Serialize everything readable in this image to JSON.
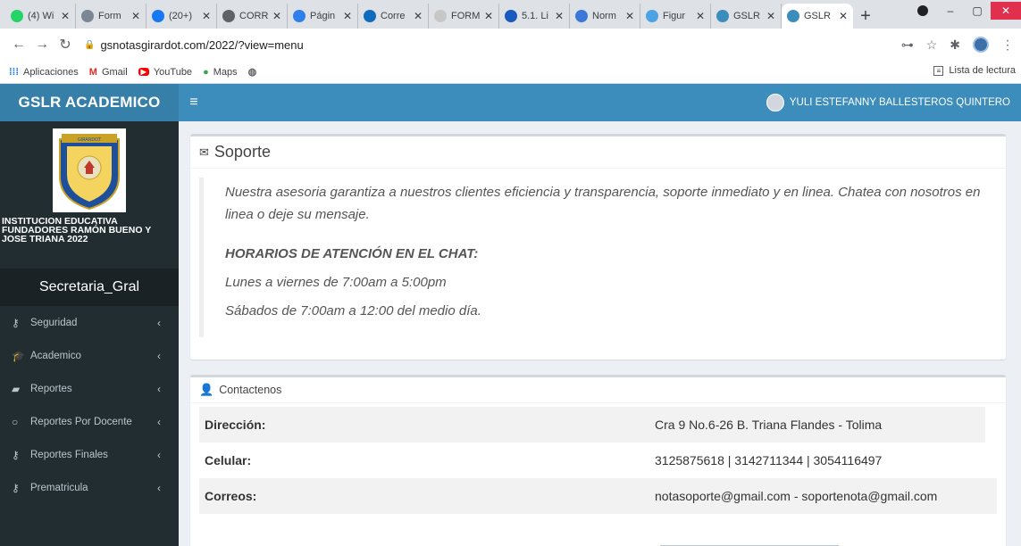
{
  "browser": {
    "tabs": [
      {
        "title": "(4) Wi",
        "color": "#25d366"
      },
      {
        "title": "Form",
        "color": "#7b8794"
      },
      {
        "title": "(20+)",
        "color": "#1877f2"
      },
      {
        "title": "CORR",
        "color": "#5f6368"
      },
      {
        "title": "Págin",
        "color": "#2f80ed"
      },
      {
        "title": "Corre",
        "color": "#0f6cbd"
      },
      {
        "title": "FORM",
        "color": "#c7c7c7"
      },
      {
        "title": "5.1. Li",
        "color": "#185abd"
      },
      {
        "title": "Norm",
        "color": "#3c78d8"
      },
      {
        "title": "Figur",
        "color": "#4ba3e3"
      },
      {
        "title": "GSLR",
        "color": "#3c8dbc"
      },
      {
        "title": "GSLR",
        "color": "#3c8dbc"
      }
    ],
    "url": "gsnotasgirardot.com/2022/?view=menu",
    "bookmarks": [
      {
        "label": "Aplicaciones",
        "icon": "apps-grid-icon"
      },
      {
        "label": "Gmail",
        "icon": "gmail-icon"
      },
      {
        "label": "YouTube",
        "icon": "youtube-icon"
      },
      {
        "label": "Maps",
        "icon": "maps-icon"
      },
      {
        "label": "",
        "icon": "globe-icon"
      }
    ],
    "reading_list": "Lista de lectura"
  },
  "app": {
    "brand": "GSLR ACADEMICO",
    "school_name": "INSTITUCION EDUCATIVA FUNDADORES RAMÓN BUENO Y JOSE TRIANA 2022",
    "crest_text": "GIRARDOT",
    "role": "Secretaria_Gral",
    "user_name": "YULI ESTEFANNY BALLESTEROS QUINTERO",
    "menu": [
      {
        "label": "Seguridad",
        "icon": "key-icon"
      },
      {
        "label": "Academico",
        "icon": "graduation-cap-icon"
      },
      {
        "label": "Reportes",
        "icon": "book-icon"
      },
      {
        "label": "Reportes Por Docente",
        "icon": "circle-icon"
      },
      {
        "label": "Reportes Finales",
        "icon": "key-icon"
      },
      {
        "label": "Prematricula",
        "icon": "key-icon"
      }
    ]
  },
  "support": {
    "title": "Soporte",
    "intro": "Nuestra asesoria garantiza a nuestros clientes eficiencia y transparencia, soporte inmediato y en linea. Chatea con nosotros en linea o deje su mensaje.",
    "hours_title": "HORARIOS DE ATENCIÓN EN EL CHAT:",
    "weekdays": "Lunes a viernes de 7:00am a 5:00pm",
    "saturday": "Sábados de 7:00am a 12:00 del medio día."
  },
  "contact": {
    "title": "Contactenos",
    "rows": [
      {
        "label": "Dirección:",
        "value": "Cra 9 No.6-26 B. Triana Flandes - Tolima"
      },
      {
        "label": "Celular:",
        "value": "3125875618 | 3142711344 | 3054116497"
      },
      {
        "label": "Correos:",
        "value": "notasoporte@gmail.com - soportenota@gmail.com"
      }
    ]
  }
}
